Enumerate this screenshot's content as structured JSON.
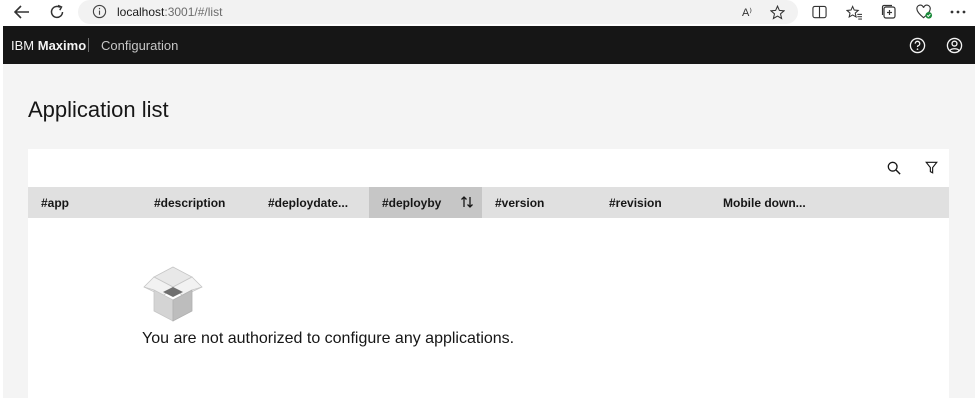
{
  "browser": {
    "url_host": "localhost",
    "url_path": ":3001/#/list",
    "read_aloud_label": "A⁾"
  },
  "header": {
    "brand_prefix": "IBM",
    "brand_name": "Maximo",
    "section": "Configuration"
  },
  "page": {
    "title": "Application list"
  },
  "table": {
    "columns": [
      {
        "label": "#app"
      },
      {
        "label": "#description"
      },
      {
        "label": "#deploydate..."
      },
      {
        "label": "#deployby",
        "sorted": true
      },
      {
        "label": "#version"
      },
      {
        "label": "#revision"
      },
      {
        "label": "Mobile down..."
      }
    ],
    "empty_message": "You are not authorized to configure any applications."
  },
  "colors": {
    "header_bg": "#161616",
    "page_bg": "#f4f4f4",
    "table_header_bg": "#e0e0e0",
    "sorted_header_bg": "#c6c6c6"
  }
}
